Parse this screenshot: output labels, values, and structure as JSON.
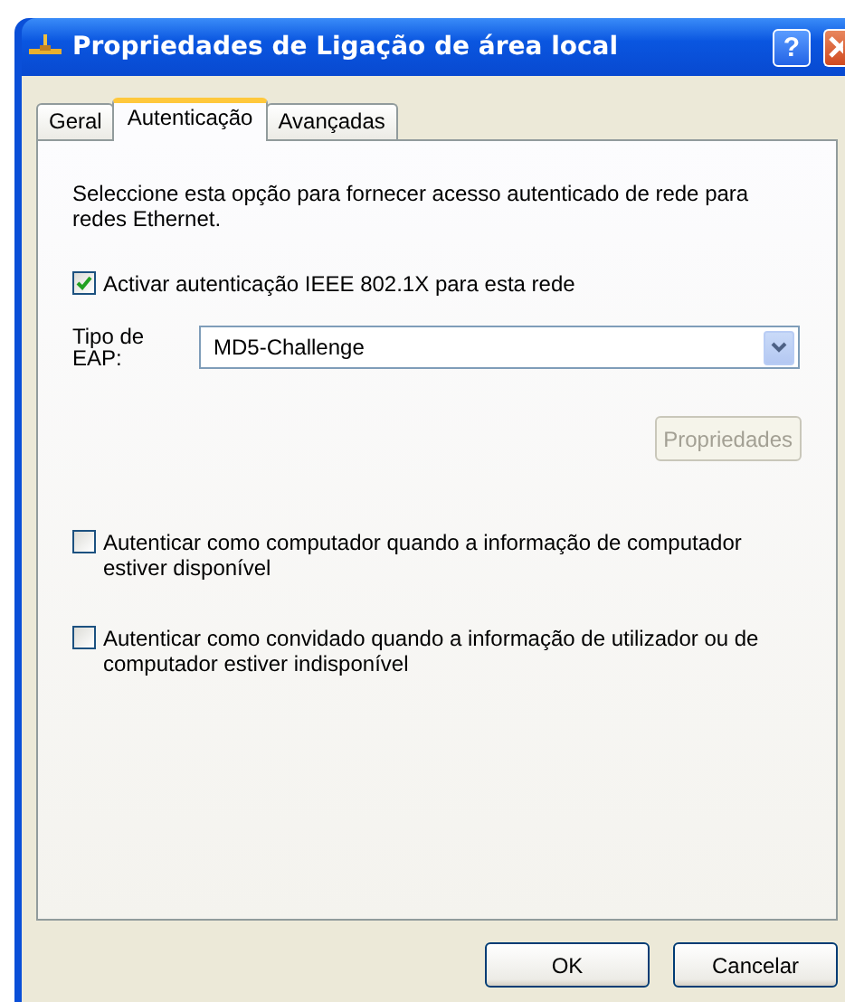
{
  "window": {
    "title": "Propriedades de Ligação de área local",
    "help_button": "?"
  },
  "tabs": [
    {
      "label": "Geral",
      "selected": false
    },
    {
      "label": "Autenticação",
      "selected": true
    },
    {
      "label": "Avançadas",
      "selected": false
    }
  ],
  "intro": "Seleccione esta opção para fornecer acesso autenticado de rede para redes Ethernet.",
  "enable_checkbox": {
    "label": "Activar autenticação IEEE 802.1X para esta rede",
    "checked": true
  },
  "eap": {
    "label": "Tipo de EAP:",
    "value": "MD5-Challenge"
  },
  "properties_button": {
    "label": "Propriedades",
    "disabled": true
  },
  "options": [
    {
      "label": "Autenticar como computador quando a informação de computador estiver disponível",
      "checked": false
    },
    {
      "label": "Autenticar como convidado quando a informação de utilizador ou de computador estiver indisponível",
      "checked": false
    }
  ],
  "buttons": [
    "OK",
    "Cancelar"
  ]
}
